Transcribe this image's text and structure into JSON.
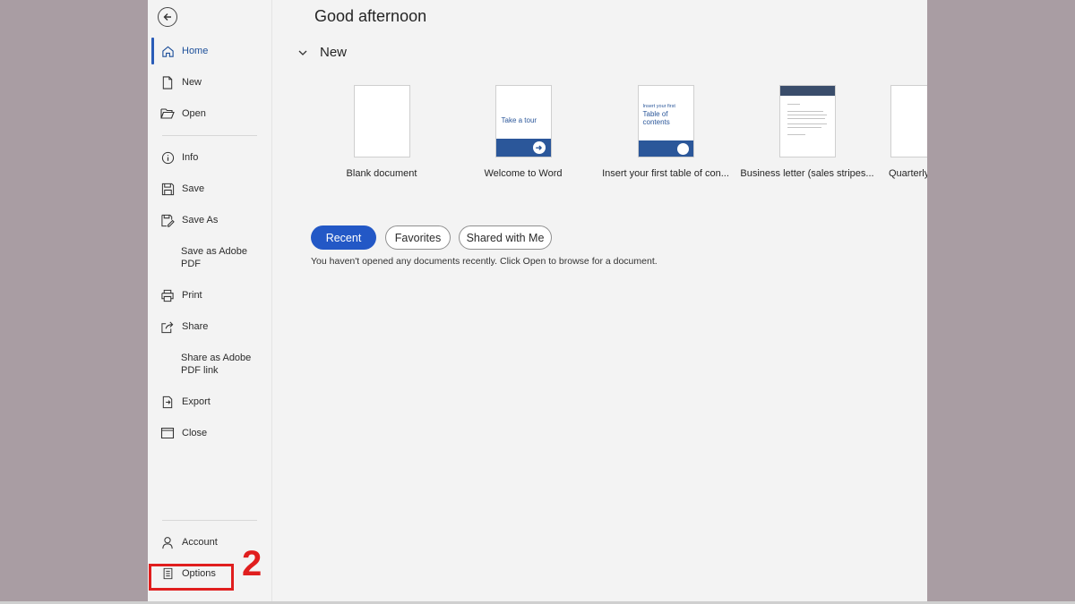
{
  "sidebar": {
    "items": [
      {
        "label": "Home",
        "icon": "home-icon"
      },
      {
        "label": "New",
        "icon": "new-doc-icon"
      },
      {
        "label": "Open",
        "icon": "folder-open-icon"
      },
      {
        "label": "Info",
        "icon": "info-icon"
      },
      {
        "label": "Save",
        "icon": "save-icon"
      },
      {
        "label": "Save As",
        "icon": "save-as-icon"
      },
      {
        "label": "Save as Adobe PDF",
        "icon": ""
      },
      {
        "label": "Print",
        "icon": "print-icon"
      },
      {
        "label": "Share",
        "icon": "share-icon"
      },
      {
        "label": "Share as Adobe PDF link",
        "icon": ""
      },
      {
        "label": "Export",
        "icon": "export-icon"
      },
      {
        "label": "Close",
        "icon": "close-folder-icon"
      }
    ],
    "account_label": "Account",
    "options_label": "Options"
  },
  "annotation": {
    "step": "2",
    "color": "#e01e1e"
  },
  "main": {
    "greeting": "Good afternoon",
    "new_section": "New",
    "templates": [
      {
        "name": "Blank document"
      },
      {
        "name": "Welcome to Word",
        "thumb_text": "Take a tour"
      },
      {
        "name": "Insert your first table of con...",
        "thumb_line1": "Insert your first",
        "thumb_line2": "Table of contents"
      },
      {
        "name": "Business letter (sales stripes..."
      },
      {
        "name": "Quarterly"
      }
    ],
    "tabs": [
      "Recent",
      "Favorites",
      "Shared with Me"
    ],
    "empty_message": "You haven't opened any documents recently. Click Open to browse for a document."
  },
  "colors": {
    "accent": "#2358c6",
    "template_blue": "#2b579a",
    "highlight": "#e01e1e"
  }
}
